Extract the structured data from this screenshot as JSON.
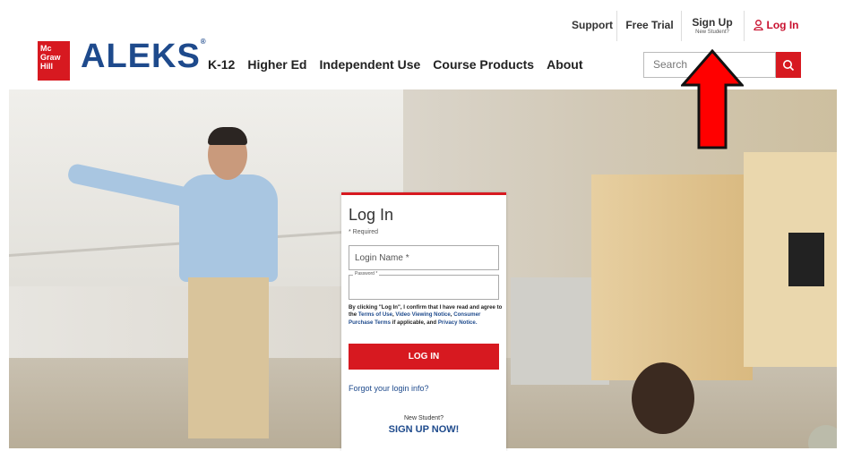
{
  "topnav": {
    "support": "Support",
    "free_trial": "Free Trial",
    "sign_up": "Sign Up",
    "sign_up_sub": "New Student?",
    "log_in": "Log In"
  },
  "header": {
    "logo_text": [
      "Mc",
      "Graw",
      "Hill"
    ],
    "brand": "ALEKS",
    "nav": [
      "K-12",
      "Higher Ed",
      "Independent Use",
      "Course Products",
      "About"
    ],
    "search_placeholder": "Search"
  },
  "login": {
    "title": "Log In",
    "required": "* Required",
    "login_name_placeholder": "Login Name *",
    "password_label": "Password *",
    "consent_prefix": "By clicking \"Log In\", I confirm that I have read and agree to the",
    "terms_of_use": "Terms of Use",
    "video_viewing_notice": "Video Viewing Notice",
    "consumer_purchase_terms": "Consumer Purchase Terms",
    "consent_middle": "if applicable, and",
    "privacy_notice": "Privacy Notice.",
    "button": "LOG IN",
    "forgot": "Forgot your login info?",
    "new_student": "New Student?",
    "signup_now": "SIGN UP NOW!"
  },
  "colors": {
    "brand_red": "#d71920",
    "brand_blue": "#1e4a8c",
    "arrow_red": "#ff0000"
  }
}
